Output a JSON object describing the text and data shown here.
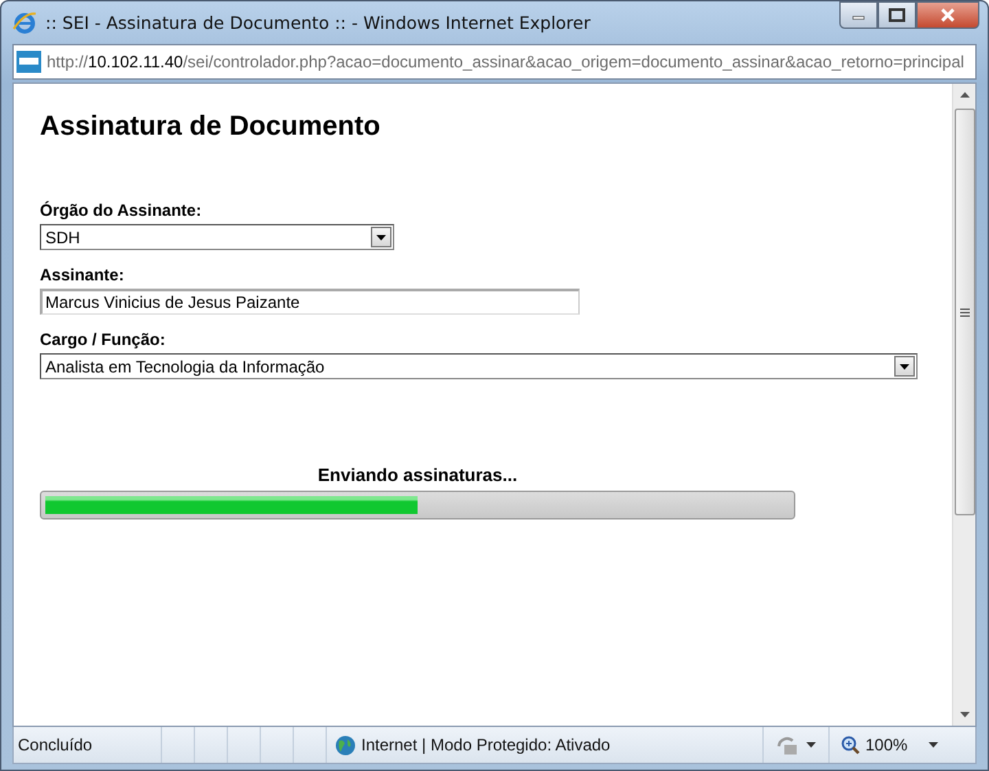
{
  "window": {
    "title": ":: SEI - Assinatura de Documento :: - Windows Internet Explorer"
  },
  "address_bar": {
    "scheme": "http://",
    "host": "10.102.11.40",
    "path": "/sei/controlador.php?acao=documento_assinar&acao_origem=documento_assinar&acao_retorno=principal"
  },
  "page": {
    "heading": "Assinatura de Documento",
    "fields": [
      {
        "kind": "select",
        "label": "Órgão do Assinante:",
        "value": "SDH"
      },
      {
        "kind": "text",
        "label": "Assinante:",
        "value": "Marcus Vinicius de Jesus Paizante"
      },
      {
        "kind": "select",
        "label": "Cargo / Função:",
        "value": "Analista em Tecnologia da Informação"
      }
    ],
    "progress": {
      "label": "Enviando assinaturas...",
      "level": 0.5
    }
  },
  "status_bar": {
    "text": "Concluído",
    "zone": "Internet | Modo Protegido: Ativado",
    "zoom": "100%"
  }
}
